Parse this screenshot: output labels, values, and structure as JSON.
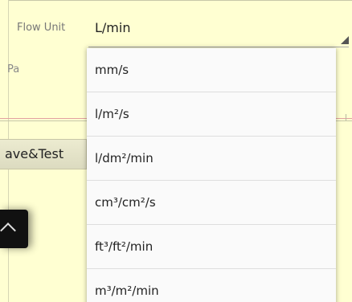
{
  "form": {
    "flow_unit_label": "Flow Unit",
    "pa_label": "Pa",
    "flow_unit_value": "L/min",
    "save_test_label": "ave&Test"
  },
  "dropdown": {
    "options": [
      "mm/s",
      "l/m²/s",
      "l/dm²/min",
      "cm³/cm²/s",
      "ft³/ft²/min",
      "m³/m²/min"
    ]
  },
  "colors": {
    "background": "#ffffd2",
    "dropdown_bg": "#fafafa",
    "divider": "#dedede",
    "separator_red": "#e3a1a1"
  }
}
